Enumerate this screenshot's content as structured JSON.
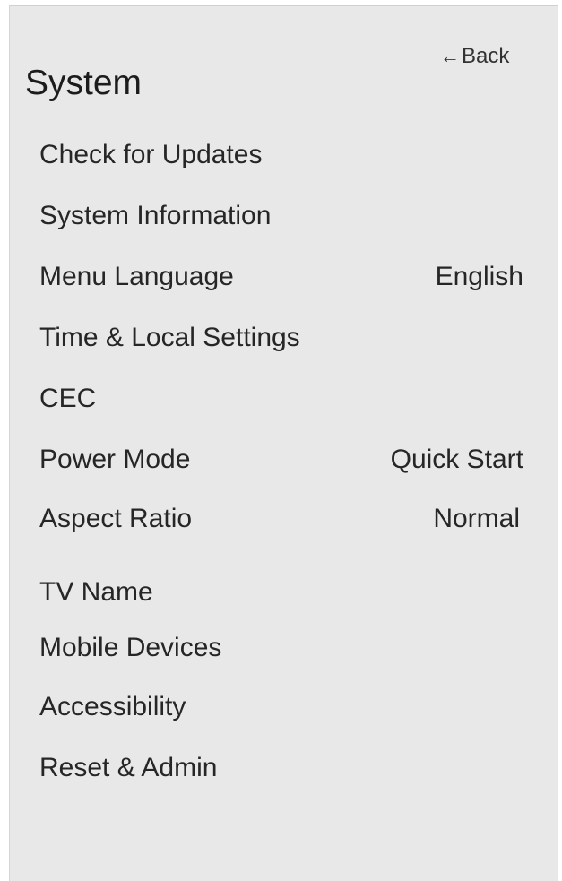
{
  "back_label": "Back",
  "title": "System",
  "menu": [
    {
      "label": "Check for Updates",
      "value": ""
    },
    {
      "label": "System Information",
      "value": ""
    },
    {
      "label": "Menu Language",
      "value": "English"
    },
    {
      "label": "Time & Local Settings",
      "value": ""
    },
    {
      "label": "CEC",
      "value": ""
    },
    {
      "label": "Power Mode",
      "value": "Quick Start"
    },
    {
      "label": "Aspect Ratio",
      "value": "Normal"
    },
    {
      "label": "TV Name",
      "value": ""
    },
    {
      "label": "Mobile Devices",
      "value": ""
    },
    {
      "label": "Accessibility",
      "value": ""
    },
    {
      "label": "Reset & Admin",
      "value": ""
    }
  ]
}
